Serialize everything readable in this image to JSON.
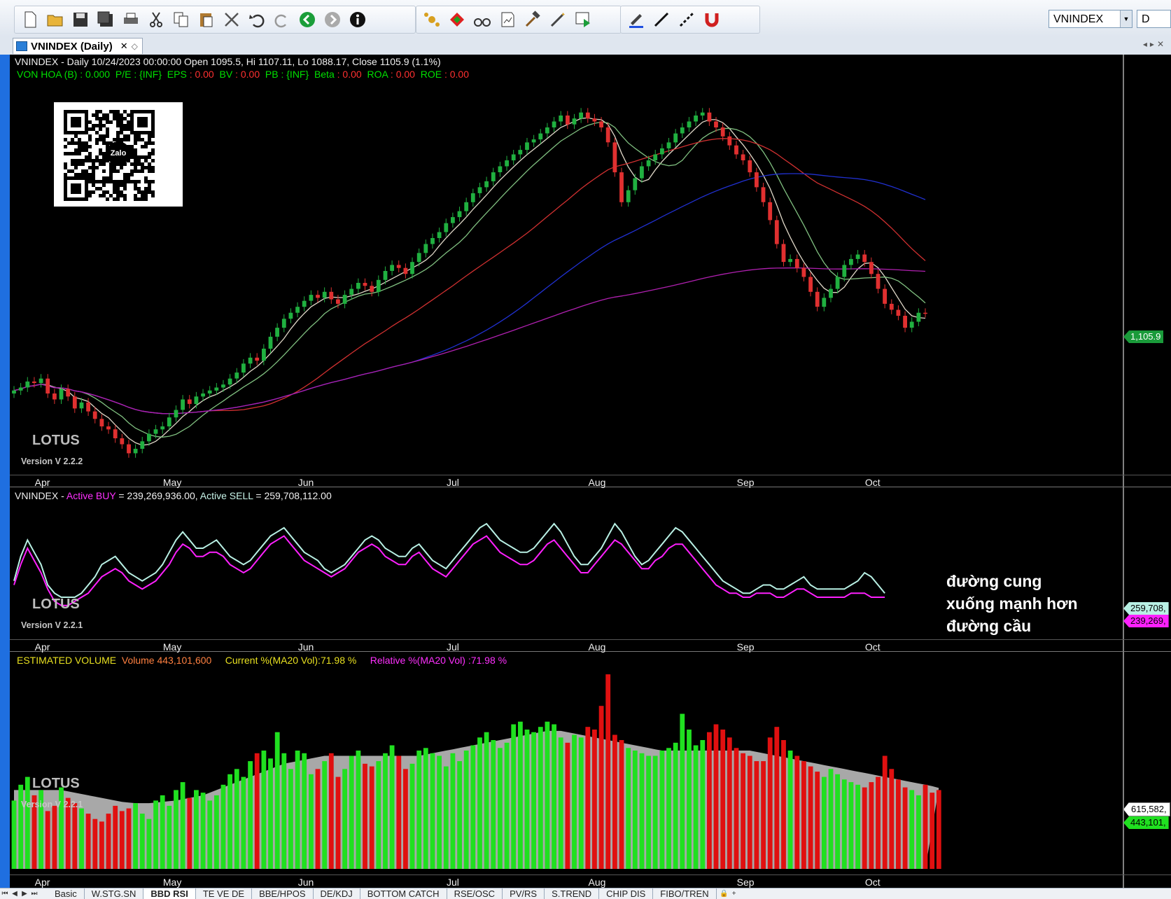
{
  "toolbar": {
    "symbol": "VNINDEX",
    "period": "D"
  },
  "tab": {
    "label": "VNINDEX (Daily)",
    "close": "✕"
  },
  "price_pane": {
    "info_line1": "VNINDEX - Daily 10/24/2023 00:00:00 Open 1095.5, Hi 1107.11, Lo 1088.17, Close 1105.9 (1.1%)",
    "fundamentals": [
      {
        "label": "VON HOA (B) :",
        "value": "0.000",
        "color": "#00e000"
      },
      {
        "label": "P/E",
        "value": ": {INF}",
        "color": "#00e000"
      },
      {
        "label": "EPS",
        "value": ": 0.00",
        "color": "#ff3030"
      },
      {
        "label": "BV",
        "value": ": 0.00",
        "color": "#ff3030"
      },
      {
        "label": "PB",
        "value": ": {INF}",
        "color": "#00e000"
      },
      {
        "label": "Beta",
        "value": ": 0.00",
        "color": "#ff3030"
      },
      {
        "label": "ROA",
        "value": ": 0.00",
        "color": "#ff3030"
      },
      {
        "label": "ROE",
        "value": ": 0.00",
        "color": "#ff3030"
      }
    ],
    "qr_center": "Zalo",
    "watermark": "LOTUS",
    "version": "Version V 2.2.2",
    "last_price_tag": "1,105.9"
  },
  "flow_pane": {
    "symbol": "VNINDEX",
    "buy_label": "Active BUY",
    "buy_value": "= 239,269,936.00,",
    "sell_label": "Active SELL",
    "sell_value": "= 259,708,112.00",
    "watermark": "LOTUS",
    "version": "Version V 2.2.1",
    "sell_tag": "259,708,",
    "buy_tag": "239,269,",
    "annotation": [
      "đường cung",
      "xuống mạnh hơn",
      "đường cầu"
    ]
  },
  "volume_pane": {
    "title": "ESTIMATED VOLUME",
    "volume": "Volume 443,101,600",
    "current": "Current %(MA20 Vol):71.98 %",
    "relative": "Relative %(MA20 Vol) :71.98 %",
    "watermark": "LOTUS",
    "version": "Version V 2.2.1",
    "ma_tag": "615,582,",
    "vol_tag": "443,101,"
  },
  "months": [
    "Apr",
    "May",
    "Jun",
    "Jul",
    "Aug",
    "Sep",
    "Oct"
  ],
  "sheet_tabs": [
    "Basic",
    "W.STG.SN",
    "BBD RSI",
    "TE VE DE",
    "BBE/HPOS",
    "DE/KDJ",
    "BOTTOM CATCH",
    "RSE/OSC",
    "PV/RS",
    "S.TREND",
    "CHIP DIS",
    "FIBO/TREN"
  ],
  "active_sheet": "BBD RSI",
  "chart_data": [
    {
      "type": "candlestick",
      "x": [
        "2023-03-31",
        "2023-04-03",
        "2023-04-04",
        "2023-04-05",
        "2023-04-06",
        "2023-04-07",
        "2023-04-10",
        "2023-04-11",
        "2023-04-12",
        "2023-04-13",
        "2023-04-14",
        "2023-04-17",
        "2023-04-18",
        "2023-04-19",
        "2023-04-20",
        "2023-04-21",
        "2023-04-24",
        "2023-04-25",
        "2023-04-26",
        "2023-04-27",
        "2023-05-04",
        "2023-05-05",
        "2023-05-08",
        "2023-05-09",
        "2023-05-10",
        "2023-05-11",
        "2023-05-12",
        "2023-05-15",
        "2023-05-16",
        "2023-05-17",
        "2023-05-18",
        "2023-05-19",
        "2023-05-22",
        "2023-05-23",
        "2023-05-24",
        "2023-05-25",
        "2023-05-26",
        "2023-05-29",
        "2023-05-30",
        "2023-05-31",
        "2023-06-01",
        "2023-06-02",
        "2023-06-05",
        "2023-06-06",
        "2023-06-07",
        "2023-06-08",
        "2023-06-09",
        "2023-06-12",
        "2023-06-13",
        "2023-06-14",
        "2023-06-15",
        "2023-06-16",
        "2023-06-19",
        "2023-06-20",
        "2023-06-21",
        "2023-06-22",
        "2023-06-23",
        "2023-06-26",
        "2023-06-27",
        "2023-06-28",
        "2023-06-29",
        "2023-06-30",
        "2023-07-03",
        "2023-07-04",
        "2023-07-05",
        "2023-07-06",
        "2023-07-07",
        "2023-07-10",
        "2023-07-11",
        "2023-07-12",
        "2023-07-13",
        "2023-07-14",
        "2023-07-17",
        "2023-07-18",
        "2023-07-19",
        "2023-07-20",
        "2023-07-21",
        "2023-07-24",
        "2023-07-25",
        "2023-07-26",
        "2023-07-27",
        "2023-07-28",
        "2023-07-31",
        "2023-08-01",
        "2023-08-02",
        "2023-08-03",
        "2023-08-04",
        "2023-08-07",
        "2023-08-08",
        "2023-08-09",
        "2023-08-10",
        "2023-08-11",
        "2023-08-14",
        "2023-08-15",
        "2023-08-16",
        "2023-08-17",
        "2023-08-18",
        "2023-08-21",
        "2023-08-22",
        "2023-08-23",
        "2023-08-24",
        "2023-08-25",
        "2023-08-28",
        "2023-08-29",
        "2023-08-30",
        "2023-09-05",
        "2023-09-06",
        "2023-09-07",
        "2023-09-08",
        "2023-09-11",
        "2023-09-12",
        "2023-09-13",
        "2023-09-14",
        "2023-09-15",
        "2023-09-18",
        "2023-09-19",
        "2023-09-20",
        "2023-09-21",
        "2023-09-22",
        "2023-09-25",
        "2023-09-26",
        "2023-09-27",
        "2023-09-28",
        "2023-09-29",
        "2023-10-02",
        "2023-10-03",
        "2023-10-04",
        "2023-10-05",
        "2023-10-06",
        "2023-10-09",
        "2023-10-10",
        "2023-10-11",
        "2023-10-12",
        "2023-10-13",
        "2023-10-16",
        "2023-10-17",
        "2023-10-18",
        "2023-10-19",
        "2023-10-20",
        "2023-10-23",
        "2023-10-24"
      ],
      "close": [
        1054,
        1056,
        1060,
        1059,
        1062,
        1052,
        1048,
        1055,
        1050,
        1042,
        1046,
        1040,
        1035,
        1030,
        1028,
        1022,
        1018,
        1012,
        1015,
        1020,
        1025,
        1028,
        1030,
        1036,
        1041,
        1048,
        1045,
        1050,
        1052,
        1054,
        1056,
        1058,
        1062,
        1066,
        1072,
        1076,
        1074,
        1082,
        1090,
        1096,
        1102,
        1106,
        1110,
        1114,
        1118,
        1116,
        1120,
        1115,
        1112,
        1118,
        1122,
        1126,
        1124,
        1120,
        1128,
        1134,
        1138,
        1136,
        1132,
        1140,
        1146,
        1152,
        1156,
        1160,
        1166,
        1170,
        1174,
        1180,
        1186,
        1190,
        1194,
        1200,
        1204,
        1208,
        1212,
        1215,
        1220,
        1222,
        1226,
        1230,
        1234,
        1238,
        1232,
        1236,
        1240,
        1236,
        1234,
        1230,
        1220,
        1200,
        1180,
        1188,
        1196,
        1204,
        1208,
        1212,
        1216,
        1220,
        1226,
        1230,
        1234,
        1238,
        1240,
        1234,
        1230,
        1224,
        1218,
        1212,
        1208,
        1200,
        1190,
        1180,
        1168,
        1152,
        1140,
        1142,
        1136,
        1130,
        1120,
        1110,
        1116,
        1122,
        1130,
        1138,
        1142,
        1145,
        1140,
        1132,
        1122,
        1112,
        1108,
        1104,
        1096,
        1100,
        1106,
        1105.9
      ]
    },
    {
      "type": "line",
      "title": "VNINDEX - Active BUY / Active SELL",
      "series": [
        {
          "name": "Active SELL",
          "color": "#b8f0e4",
          "values": [
            10,
            16,
            20,
            17,
            14,
            9,
            7,
            6,
            6,
            6,
            7,
            9,
            11,
            14,
            15,
            16,
            14,
            12,
            11,
            10,
            11,
            12,
            14,
            17,
            20,
            22,
            20,
            18,
            18,
            19,
            20,
            18,
            16,
            15,
            14,
            15,
            17,
            19,
            21,
            22,
            23,
            21,
            19,
            17,
            16,
            15,
            13,
            12,
            13,
            14,
            16,
            18,
            20,
            21,
            20,
            18,
            17,
            16,
            16,
            18,
            19,
            17,
            15,
            14,
            13,
            15,
            17,
            19,
            21,
            23,
            24,
            22,
            20,
            19,
            18,
            17,
            17,
            18,
            20,
            22,
            24,
            22,
            19,
            16,
            14,
            14,
            16,
            18,
            21,
            24,
            22,
            19,
            16,
            14,
            15,
            17,
            19,
            21,
            23,
            22,
            20,
            18,
            16,
            14,
            12,
            10,
            9,
            8,
            7,
            7,
            8,
            9,
            9,
            8,
            8,
            9,
            10,
            11,
            9,
            8,
            8,
            8,
            8,
            8,
            9,
            10,
            12,
            11,
            9,
            7
          ]
        },
        {
          "name": "Active BUY",
          "color": "#ff20ff",
          "values": [
            9,
            14,
            18,
            15,
            12,
            8,
            5,
            4,
            4,
            5,
            6,
            7,
            9,
            11,
            12,
            13,
            12,
            10,
            9,
            8,
            9,
            10,
            12,
            14,
            17,
            19,
            18,
            16,
            16,
            17,
            17,
            16,
            14,
            13,
            12,
            13,
            15,
            17,
            19,
            20,
            21,
            19,
            17,
            15,
            14,
            13,
            12,
            11,
            12,
            13,
            15,
            17,
            18,
            19,
            18,
            16,
            15,
            14,
            14,
            16,
            17,
            15,
            13,
            12,
            11,
            13,
            15,
            17,
            19,
            20,
            21,
            19,
            17,
            16,
            15,
            14,
            14,
            15,
            17,
            19,
            20,
            18,
            16,
            14,
            12,
            12,
            14,
            16,
            18,
            20,
            19,
            17,
            15,
            13,
            13,
            15,
            16,
            18,
            19,
            19,
            17,
            15,
            13,
            11,
            9,
            8,
            7,
            7,
            6,
            6,
            7,
            7,
            7,
            6,
            6,
            7,
            8,
            8,
            7,
            6,
            6,
            6,
            6,
            6,
            7,
            7,
            7,
            6,
            6,
            6
          ]
        }
      ]
    },
    {
      "type": "bar",
      "title": "ESTIMATED VOLUME",
      "series": [
        {
          "name": "Volume",
          "values": [
            520,
            640,
            700,
            560,
            600,
            440,
            480,
            620,
            540,
            500,
            460,
            420,
            380,
            360,
            420,
            480,
            440,
            460,
            500,
            420,
            380,
            520,
            560,
            480,
            600,
            660,
            540,
            600,
            580,
            520,
            560,
            640,
            720,
            760,
            700,
            820,
            880,
            900,
            840,
            1040,
            880,
            760,
            900,
            880,
            720,
            760,
            820,
            880,
            700,
            760,
            860,
            900,
            800,
            780,
            820,
            880,
            940,
            860,
            760,
            800,
            900,
            920,
            880,
            860,
            780,
            880,
            820,
            900,
            940,
            1000,
            1040,
            980,
            920,
            960,
            1100,
            1120,
            1060,
            1040,
            1080,
            1120,
            1100,
            1000,
            960,
            1020,
            1000,
            1080,
            1060,
            1240,
            1480,
            1020,
            980,
            920,
            900,
            880,
            860,
            860,
            900,
            920,
            960,
            1180,
            1060,
            940,
            980,
            1040,
            1100,
            1060,
            1000,
            920,
            880,
            860,
            820,
            820,
            1000,
            1080,
            980,
            900,
            860,
            820,
            780,
            740,
            700,
            760,
            720,
            680,
            660,
            640,
            620,
            660,
            700,
            860,
            760,
            680,
            620,
            600,
            560,
            640,
            580,
            600
          ]
        },
        {
          "name": "MA20 Vol",
          "values": [
            600,
            600,
            600,
            600,
            600,
            600,
            600,
            600,
            590,
            580,
            570,
            560,
            550,
            540,
            530,
            520,
            510,
            505,
            500,
            500,
            500,
            505,
            510,
            515,
            520,
            530,
            540,
            550,
            560,
            580,
            600,
            620,
            640,
            660,
            680,
            700,
            720,
            740,
            760,
            780,
            800,
            810,
            820,
            830,
            840,
            850,
            860,
            860,
            860,
            860,
            860,
            860,
            860,
            860,
            860,
            860,
            860,
            860,
            860,
            860,
            860,
            870,
            880,
            890,
            900,
            910,
            920,
            930,
            940,
            950,
            960,
            970,
            980,
            990,
            1000,
            1010,
            1020,
            1030,
            1040,
            1050,
            1050,
            1050,
            1040,
            1030,
            1020,
            1010,
            1000,
            990,
            980,
            970,
            960,
            950,
            940,
            930,
            920,
            910,
            900,
            900,
            900,
            900,
            900,
            900,
            900,
            900,
            900,
            900,
            900,
            900,
            900,
            900,
            890,
            880,
            870,
            860,
            850,
            840,
            830,
            820,
            810,
            800,
            790,
            780,
            770,
            760,
            750,
            740,
            730,
            720,
            710,
            700,
            690,
            680,
            670,
            660,
            650,
            640,
            630,
            615.6
          ]
        }
      ]
    }
  ]
}
